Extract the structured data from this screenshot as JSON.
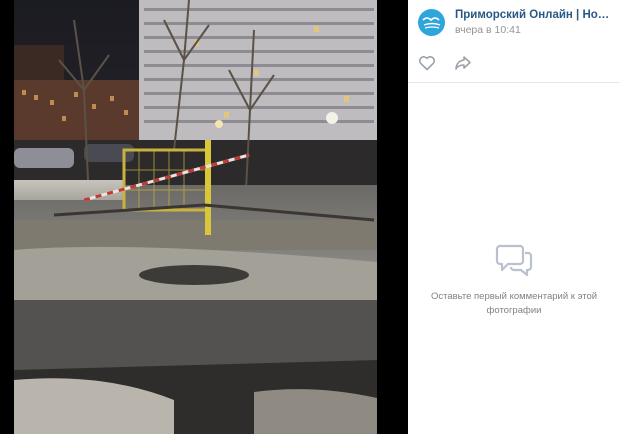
{
  "post": {
    "author_name": "Приморский Онлайн | Новости н…",
    "time": "вчера в 10:41"
  },
  "icons": {
    "avatar": "seagull-logo-icon",
    "like": "heart-icon",
    "share": "share-arrow-icon",
    "empty_comments": "comment-bubbles-icon"
  },
  "comments": {
    "empty_text": "Оставьте первый комментарий к этой фотографии"
  },
  "colors": {
    "author_link": "#2a5885",
    "avatar_bg": "#2ea6dc",
    "muted": "#939393"
  }
}
